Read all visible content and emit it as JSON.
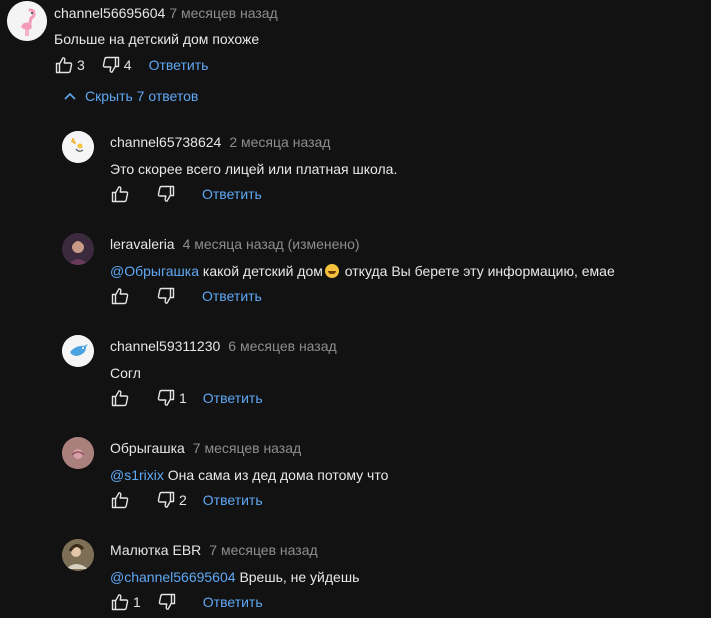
{
  "top_comment": {
    "author": "channel56695604",
    "time": "7 месяцев назад",
    "text": "Больше на детский дом похоже",
    "likes": "3",
    "dislikes": "4",
    "reply_label": "Ответить"
  },
  "toggle_label": "Скрыть 7 ответов",
  "replies": [
    {
      "author": "channel65738624",
      "time": "2 месяца назад",
      "mention": "",
      "text": "Это скорее всего лицей или платная школа.",
      "likes": "",
      "dislikes": "",
      "reply_label": "Ответить"
    },
    {
      "author": "leravaleria",
      "time": "4 месяца назад (изменено)",
      "mention": "@Обрыгашка",
      "text": "какой детский дом",
      "text_after_emoji": " откуда Вы берете эту информацию, емае",
      "likes": "",
      "dislikes": "",
      "reply_label": "Ответить"
    },
    {
      "author": "channel59311230",
      "time": "6 месяцев назад",
      "mention": "",
      "text": "Согл",
      "likes": "",
      "dislikes": "1",
      "reply_label": "Ответить"
    },
    {
      "author": "Обрыгашка",
      "time": "7 месяцев назад",
      "mention": "@s1rixix",
      "text": "Она сама из дед дома потому что",
      "likes": "",
      "dislikes": "2",
      "reply_label": "Ответить"
    },
    {
      "author": "Малютка EBR",
      "time": "7 месяцев назад",
      "mention": "@channel56695604",
      "text": "Врешь, не уйдешь",
      "likes": "1",
      "dislikes": "",
      "reply_label": "Ответить"
    }
  ],
  "colors": {
    "background": "#121212",
    "link": "#5fa8f5",
    "muted": "#8d8d8d"
  }
}
